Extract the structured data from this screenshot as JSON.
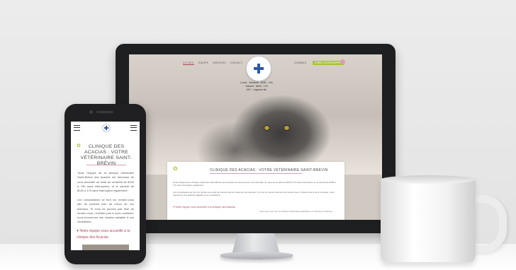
{
  "desktop": {
    "nav": {
      "links": [
        "ACCUEIL",
        "ÉQUIPE",
        "SERVICES",
        "CONTACT"
      ],
      "contact_label": "CONSEILS",
      "cta_label": "CRÉEZ VOTRE RAPPEL"
    },
    "hours": [
      "Lundi - Vendredi : 8h30 - 19h",
      "Samedi : 8h30 - 17h",
      "24/7 - Urgence tél."
    ],
    "card": {
      "title": "CLINIQUE DES ACACIAS : VOTRE VÉTÉRINAIRE SAINT-BRÉVIN",
      "paragraph1": "Toute l'équipe de la clinique vétérinaire Saint-Brévin des Acacias est heureuse de vous accueillir. Ici, avec la sécurité de 8h30 à 17h sans interruption, et le samedi de 8h30 à 17h sans interruption également.",
      "paragraph2": "Les consultations se font sur rendez-vous afin de prendre soin au mieux de vos animaux. Si vous ne pouvez pas fixer de rendez-vous, n'hésitez pas à nous contacter, nous trouverons une solution adaptée à vos contraintes.",
      "team_line": "Notre équipe vous accueille à la clinique des Acacias",
      "side_note": "Vous serez reçu par nos docteurs vétérinaires spécialisés et confirmés en chirurgie"
    }
  },
  "phone": {
    "title": "CLINIQUE DES ACACIAS : VOTRE VÉTÉRINAIRE SAINT-BRÉVIN",
    "paragraph1": "Toute l'équipe de la clinique vétérinaire Saint-Brévin des Acacias est heureuse de vous accueillir du lundi au vendredi de 8h30 à 19h sans interruption, et le samedi de 8h30 à 17h sans interruption également.",
    "paragraph2": "Les consultations se font sur rendez-vous afin de prendre soin au mieux de vos animaux. Si vous ne pouvez pas fixer de rendez-vous, n'hésitez pas à nous contacter, nous trouverons une solution adaptée à vos contraintes.",
    "team_line": "Notre équipe vous accueille à la clinique des Acacias"
  },
  "colors": {
    "accent_green": "#a7c43a",
    "accent_rose": "#b0485a",
    "logo_blue": "#2f57a3"
  }
}
